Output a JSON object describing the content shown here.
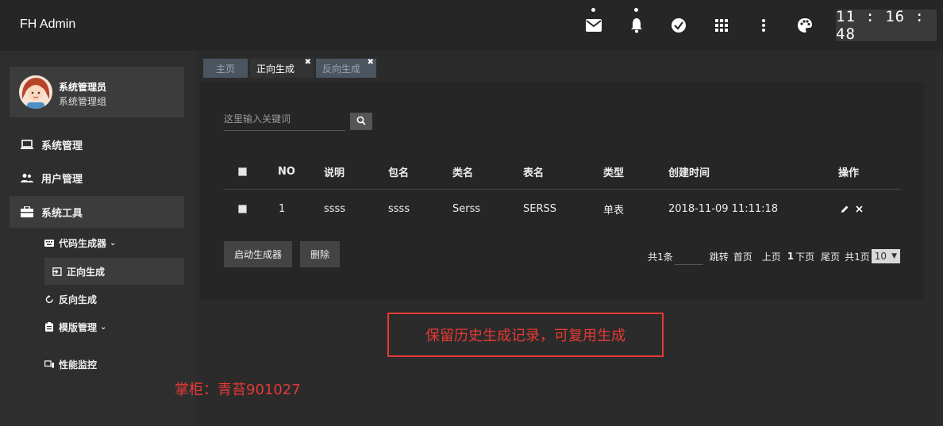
{
  "app": {
    "title": "FH Admin"
  },
  "topbar": {
    "icons": [
      "mail-icon",
      "bell-icon",
      "check-circle-icon",
      "grid-icon",
      "more-vert-icon",
      "palette-icon"
    ],
    "clock": "11 : 16 : 48"
  },
  "profile": {
    "name": "系统管理员",
    "group": "系统管理组"
  },
  "sidebar": {
    "items": [
      {
        "label": "系统管理"
      },
      {
        "label": "用户管理"
      },
      {
        "label": "系统工具"
      }
    ],
    "sub": [
      {
        "label": "代码生成器"
      },
      {
        "label": "正向生成"
      },
      {
        "label": "反向生成"
      },
      {
        "label": "模版管理"
      },
      {
        "label": "性能监控"
      }
    ]
  },
  "tabs": [
    {
      "label": "主页"
    },
    {
      "label": "正向生成"
    },
    {
      "label": "反向生成"
    }
  ],
  "search": {
    "placeholder": "这里输入关键词"
  },
  "table": {
    "headers": [
      "NO",
      "说明",
      "包名",
      "类名",
      "表名",
      "类型",
      "创建时间",
      "操作"
    ],
    "rows": [
      {
        "no": "1",
        "desc": "ssss",
        "package": "ssss",
        "class": "Serss",
        "table": "SERSS",
        "type": "单表",
        "created": "2018-11-09 11:11:18"
      }
    ]
  },
  "buttons": {
    "start": "启动生成器",
    "delete": "删除"
  },
  "pager": {
    "total": "共1条",
    "jump": "跳转",
    "first": "首页",
    "prev": "上页",
    "current": "1",
    "next": "下页",
    "last": "尾页",
    "pages": "共1页",
    "page_size": "10"
  },
  "annotations": {
    "box_text": "保留历史生成记录，可复用生成",
    "note": "掌柜：青苔901027"
  },
  "colors": {
    "accent_red": "#e53935",
    "panel_bg": "#262626",
    "page_bg": "#2b2b2b"
  }
}
